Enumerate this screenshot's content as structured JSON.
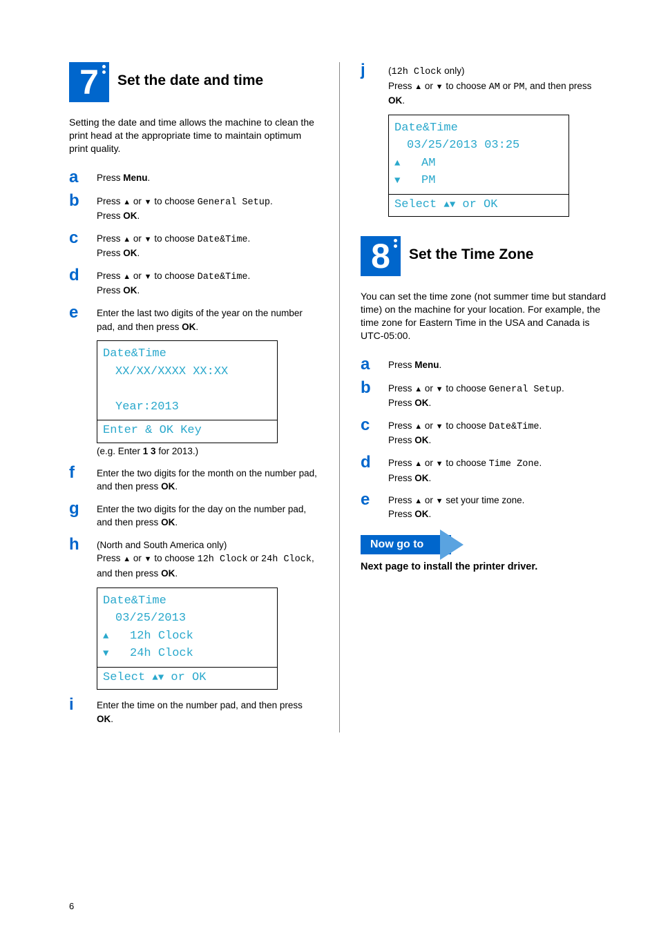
{
  "page_number": "6",
  "section7": {
    "number": "7",
    "title": "Set the date and time",
    "intro": "Setting the date and time allows the machine to clean the print head at the appropriate time to maintain optimum print quality.",
    "steps": {
      "a": {
        "text_pre": "Press ",
        "bold": "Menu",
        "text_post": "."
      },
      "b": {
        "line1_pre": "Press ",
        "line1_mid": " or ",
        "line1_post": " to choose ",
        "mono": "General Setup",
        "dot": ".",
        "line2": "Press ",
        "line2_bold": "OK",
        "line2_dot": "."
      },
      "c": {
        "mono": "Date&Time"
      },
      "d": {
        "mono": "Date&Time"
      },
      "e": {
        "text": "Enter the last two digits of the year on the number pad, and then press ",
        "bold": "OK",
        "dot": "."
      },
      "f": {
        "text": "Enter the two digits for the month on the number pad, and then press ",
        "bold": "OK",
        "dot": "."
      },
      "g": {
        "text": "Enter the two digits for the day on the number pad, and then press ",
        "bold": "OK",
        "dot": "."
      },
      "h": {
        "note": "(North and South America only)",
        "line_pre": "Press ",
        "line_mid": " or ",
        "line_post": " to choose ",
        "mono1": "12h Clock",
        "or": " or ",
        "mono2": "24h Clock",
        "then": ", and then press ",
        "bold": "OK",
        "dot": "."
      },
      "i": {
        "text": "Enter the time on the number pad, and then press ",
        "bold": "OK",
        "dot": "."
      },
      "j": {
        "note_open": "(",
        "note_mono": "12h Clock",
        "note_close": " only)",
        "line_pre": "Press ",
        "line_mid": " or ",
        "line_post": " to choose ",
        "mono1": "AM",
        "or": " or ",
        "mono2": "PM",
        "then": ", and then press ",
        "bold": "OK",
        "dot": "."
      }
    },
    "lcd1": {
      "l1": "Date&Time",
      "l2": "XX/XX/XXXX XX:XX",
      "l3": "Year:2013",
      "footer": "Enter & OK Key"
    },
    "eg": "(e.g. Enter ",
    "eg_bold": "1 3",
    "eg_post": " for 2013.)",
    "lcd2": {
      "l1": "Date&Time",
      "l2": "03/25/2013",
      "opt1": "12h Clock",
      "opt2": "24h Clock",
      "footer_pre": "Select ",
      "footer_post": " or OK"
    },
    "lcd3": {
      "l1": "Date&Time",
      "l2": "03/25/2013 03:25",
      "opt1": "AM",
      "opt2": "PM",
      "footer_pre": "Select ",
      "footer_post": " or OK"
    }
  },
  "section8": {
    "number": "8",
    "title": "Set the Time Zone",
    "intro": "You can set the time zone (not summer time but standard time) on the machine for your location. For example, the time zone for Eastern Time in the USA and Canada is UTC-05:00.",
    "steps": {
      "a": {
        "text_pre": "Press ",
        "bold": "Menu",
        "dot": "."
      },
      "b": {
        "mono": "General Setup"
      },
      "c": {
        "mono": "Date&Time"
      },
      "d": {
        "mono": "Time Zone"
      },
      "e": {
        "line_pre": "Press ",
        "line_mid": " or ",
        "line_post": " set your time zone.",
        "line2_pre": "Press ",
        "line2_bold": "OK",
        "line2_dot": "."
      }
    }
  },
  "nowgoto": {
    "label": "Now go to",
    "text": "Next page to install the printer driver."
  }
}
